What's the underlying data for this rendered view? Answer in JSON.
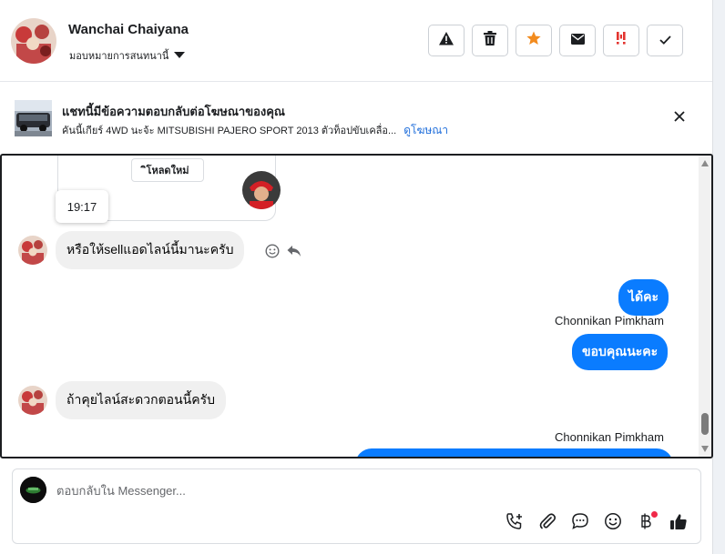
{
  "header": {
    "contact_name": "Wanchai Chaiyana",
    "assign_label": "มอบหมายการสนทนานี้",
    "action_icons": [
      "spam-warning-icon",
      "trash-icon",
      "star-icon",
      "mail-icon",
      "urgent-icon",
      "check-icon"
    ],
    "star_color": "#f28b1e",
    "urgent_color": "#e3342f"
  },
  "ad": {
    "title": "แชทนี้มีข้อความตอบกลับต่อโฆษณาของคุณ",
    "description": "คันนี้เกียร์ 4WD นะจ้ะ MITSUBISHI PAJERO SPORT 2013 ตัวท็อปขับเคลื่อ...",
    "link": "ดูโฆษณา"
  },
  "chat": {
    "reload_label": "โหลดใหม่",
    "reload_icon": "ิ",
    "tooltip_time": "19:17",
    "messages": [
      {
        "direction": "in",
        "text": "หรือให้sellแอดไลน์นี้มานะครับ"
      },
      {
        "direction": "out",
        "text": "ได้คะ"
      },
      {
        "direction": "out",
        "sender": "Chonnikan Pimkham",
        "text": "ขอบคุณนะคะ"
      },
      {
        "direction": "in",
        "text": "ถ้าคุยไลน์สะดวกตอนนี้ครับ"
      },
      {
        "direction": "out",
        "sender": "Chonnikan Pimkham",
        "text": ""
      }
    ]
  },
  "composer": {
    "placeholder": "ตอบกลับใน Messenger...",
    "tool_icons": [
      "call-add-icon",
      "attachment-icon",
      "saved-reply-icon",
      "emoji-icon",
      "baht-payment-icon",
      "thumbs-up-icon"
    ]
  },
  "colors": {
    "accent_blue": "#0a7cff",
    "link_blue": "#216fdb",
    "incoming_bubble": "#f0f0f0"
  }
}
